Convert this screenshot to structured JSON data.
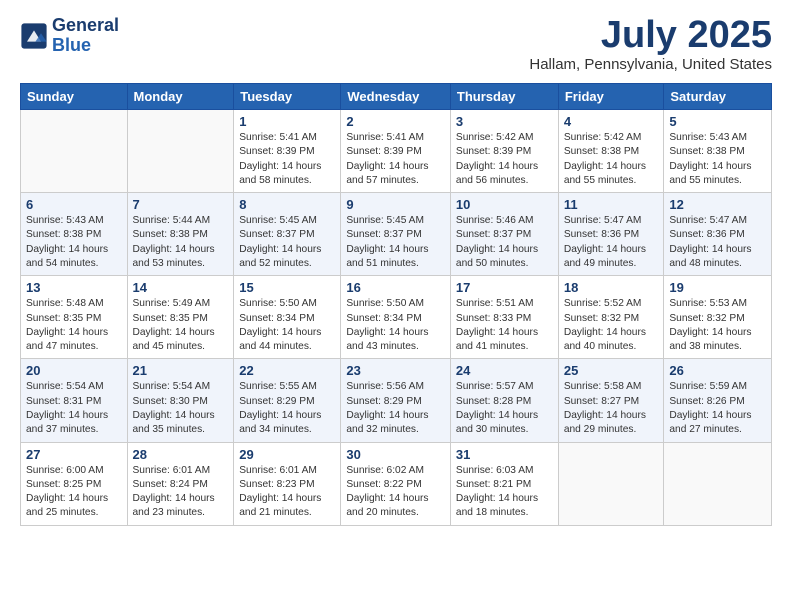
{
  "header": {
    "logo_line1": "General",
    "logo_line2": "Blue",
    "month": "July 2025",
    "location": "Hallam, Pennsylvania, United States"
  },
  "weekdays": [
    "Sunday",
    "Monday",
    "Tuesday",
    "Wednesday",
    "Thursday",
    "Friday",
    "Saturday"
  ],
  "weeks": [
    [
      {
        "day": "",
        "content": ""
      },
      {
        "day": "",
        "content": ""
      },
      {
        "day": "1",
        "content": "Sunrise: 5:41 AM\nSunset: 8:39 PM\nDaylight: 14 hours\nand 58 minutes."
      },
      {
        "day": "2",
        "content": "Sunrise: 5:41 AM\nSunset: 8:39 PM\nDaylight: 14 hours\nand 57 minutes."
      },
      {
        "day": "3",
        "content": "Sunrise: 5:42 AM\nSunset: 8:39 PM\nDaylight: 14 hours\nand 56 minutes."
      },
      {
        "day": "4",
        "content": "Sunrise: 5:42 AM\nSunset: 8:38 PM\nDaylight: 14 hours\nand 55 minutes."
      },
      {
        "day": "5",
        "content": "Sunrise: 5:43 AM\nSunset: 8:38 PM\nDaylight: 14 hours\nand 55 minutes."
      }
    ],
    [
      {
        "day": "6",
        "content": "Sunrise: 5:43 AM\nSunset: 8:38 PM\nDaylight: 14 hours\nand 54 minutes."
      },
      {
        "day": "7",
        "content": "Sunrise: 5:44 AM\nSunset: 8:38 PM\nDaylight: 14 hours\nand 53 minutes."
      },
      {
        "day": "8",
        "content": "Sunrise: 5:45 AM\nSunset: 8:37 PM\nDaylight: 14 hours\nand 52 minutes."
      },
      {
        "day": "9",
        "content": "Sunrise: 5:45 AM\nSunset: 8:37 PM\nDaylight: 14 hours\nand 51 minutes."
      },
      {
        "day": "10",
        "content": "Sunrise: 5:46 AM\nSunset: 8:37 PM\nDaylight: 14 hours\nand 50 minutes."
      },
      {
        "day": "11",
        "content": "Sunrise: 5:47 AM\nSunset: 8:36 PM\nDaylight: 14 hours\nand 49 minutes."
      },
      {
        "day": "12",
        "content": "Sunrise: 5:47 AM\nSunset: 8:36 PM\nDaylight: 14 hours\nand 48 minutes."
      }
    ],
    [
      {
        "day": "13",
        "content": "Sunrise: 5:48 AM\nSunset: 8:35 PM\nDaylight: 14 hours\nand 47 minutes."
      },
      {
        "day": "14",
        "content": "Sunrise: 5:49 AM\nSunset: 8:35 PM\nDaylight: 14 hours\nand 45 minutes."
      },
      {
        "day": "15",
        "content": "Sunrise: 5:50 AM\nSunset: 8:34 PM\nDaylight: 14 hours\nand 44 minutes."
      },
      {
        "day": "16",
        "content": "Sunrise: 5:50 AM\nSunset: 8:34 PM\nDaylight: 14 hours\nand 43 minutes."
      },
      {
        "day": "17",
        "content": "Sunrise: 5:51 AM\nSunset: 8:33 PM\nDaylight: 14 hours\nand 41 minutes."
      },
      {
        "day": "18",
        "content": "Sunrise: 5:52 AM\nSunset: 8:32 PM\nDaylight: 14 hours\nand 40 minutes."
      },
      {
        "day": "19",
        "content": "Sunrise: 5:53 AM\nSunset: 8:32 PM\nDaylight: 14 hours\nand 38 minutes."
      }
    ],
    [
      {
        "day": "20",
        "content": "Sunrise: 5:54 AM\nSunset: 8:31 PM\nDaylight: 14 hours\nand 37 minutes."
      },
      {
        "day": "21",
        "content": "Sunrise: 5:54 AM\nSunset: 8:30 PM\nDaylight: 14 hours\nand 35 minutes."
      },
      {
        "day": "22",
        "content": "Sunrise: 5:55 AM\nSunset: 8:29 PM\nDaylight: 14 hours\nand 34 minutes."
      },
      {
        "day": "23",
        "content": "Sunrise: 5:56 AM\nSunset: 8:29 PM\nDaylight: 14 hours\nand 32 minutes."
      },
      {
        "day": "24",
        "content": "Sunrise: 5:57 AM\nSunset: 8:28 PM\nDaylight: 14 hours\nand 30 minutes."
      },
      {
        "day": "25",
        "content": "Sunrise: 5:58 AM\nSunset: 8:27 PM\nDaylight: 14 hours\nand 29 minutes."
      },
      {
        "day": "26",
        "content": "Sunrise: 5:59 AM\nSunset: 8:26 PM\nDaylight: 14 hours\nand 27 minutes."
      }
    ],
    [
      {
        "day": "27",
        "content": "Sunrise: 6:00 AM\nSunset: 8:25 PM\nDaylight: 14 hours\nand 25 minutes."
      },
      {
        "day": "28",
        "content": "Sunrise: 6:01 AM\nSunset: 8:24 PM\nDaylight: 14 hours\nand 23 minutes."
      },
      {
        "day": "29",
        "content": "Sunrise: 6:01 AM\nSunset: 8:23 PM\nDaylight: 14 hours\nand 21 minutes."
      },
      {
        "day": "30",
        "content": "Sunrise: 6:02 AM\nSunset: 8:22 PM\nDaylight: 14 hours\nand 20 minutes."
      },
      {
        "day": "31",
        "content": "Sunrise: 6:03 AM\nSunset: 8:21 PM\nDaylight: 14 hours\nand 18 minutes."
      },
      {
        "day": "",
        "content": ""
      },
      {
        "day": "",
        "content": ""
      }
    ]
  ]
}
